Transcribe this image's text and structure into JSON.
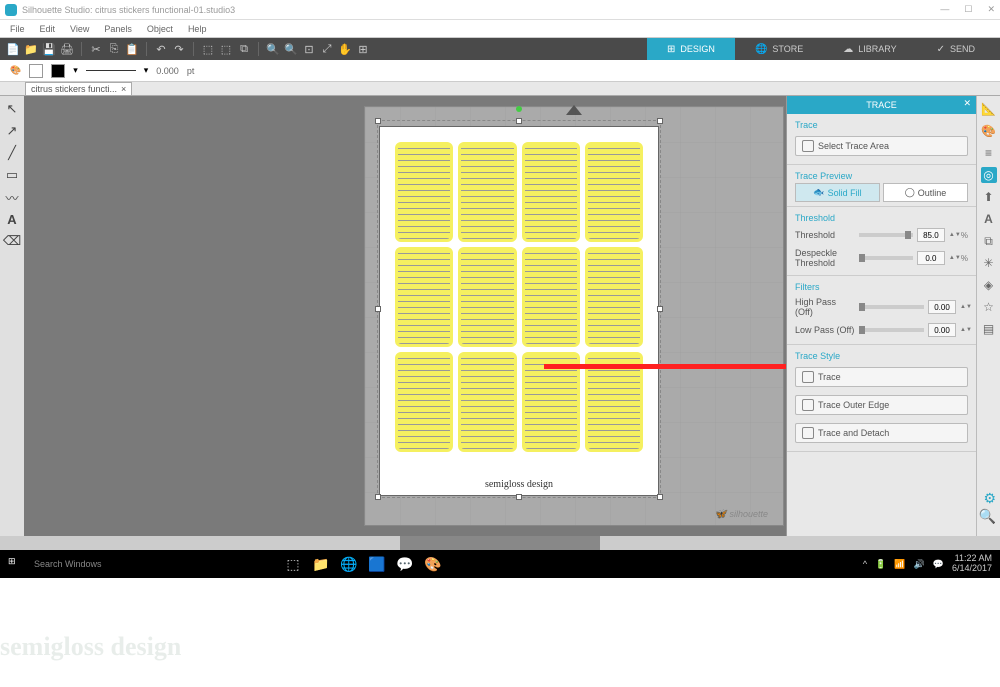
{
  "window": {
    "title": "Silhouette Studio: citrus stickers functional-01.studio3",
    "min": "—",
    "max": "☐",
    "close": "✕"
  },
  "menu": [
    "File",
    "Edit",
    "View",
    "Panels",
    "Object",
    "Help"
  ],
  "nav": {
    "design": "DESIGN",
    "store": "STORE",
    "library": "LIBRARY",
    "send": "SEND"
  },
  "properties": {
    "stroke_value": "0.000",
    "stroke_unit": "pt"
  },
  "doc_tab": "citrus stickers functi...",
  "canvas": {
    "watermark": "semigloss design",
    "mat_brand": "silhouette"
  },
  "trace": {
    "title": "TRACE",
    "close": "✕",
    "sec_trace": "Trace",
    "select_area": "Select Trace Area",
    "sec_preview": "Trace Preview",
    "solid_fill": "Solid Fill",
    "outline": "Outline",
    "sec_threshold": "Threshold",
    "threshold_label": "Threshold",
    "threshold_val": "85.0",
    "despeckle_label": "Despeckle Threshold",
    "despeckle_val": "0.0",
    "sec_filters": "Filters",
    "highpass_label": "High Pass (Off)",
    "highpass_val": "0.00",
    "lowpass_label": "Low Pass (Off)",
    "lowpass_val": "0.00",
    "sec_style": "Trace Style",
    "trace_btn": "Trace",
    "trace_outer": "Trace Outer Edge",
    "trace_detach": "Trace and Detach",
    "percent": "%"
  },
  "taskbar": {
    "search": "Search Windows",
    "time": "11:22 AM",
    "date": "6/14/2017"
  },
  "bottom_watermark": "semigloss design"
}
